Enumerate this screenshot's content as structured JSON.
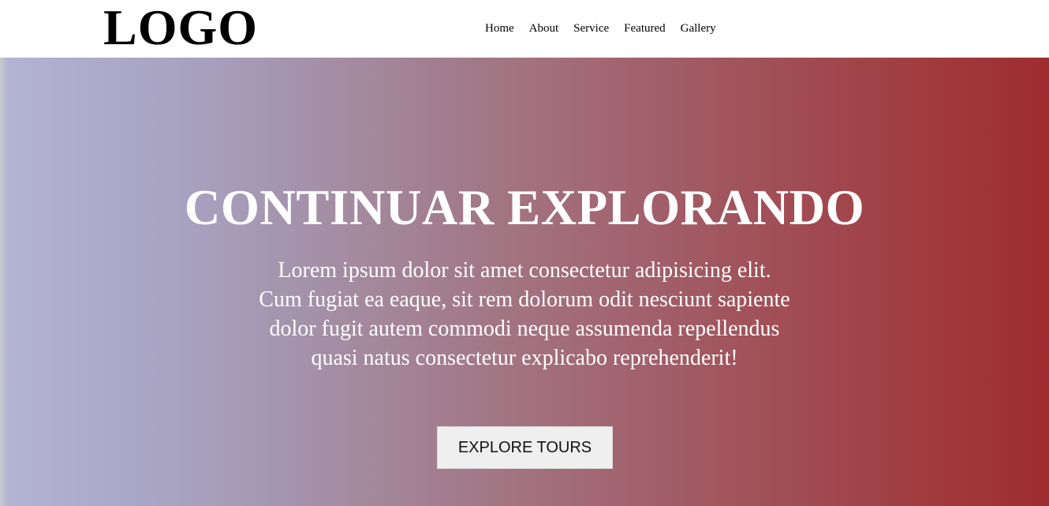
{
  "header": {
    "logo": "LOGO",
    "nav": [
      "Home",
      "About",
      "Service",
      "Featured",
      "Gallery"
    ]
  },
  "hero": {
    "title": "CONTINUAR EXPLORANDO",
    "text": "Lorem ipsum dolor sit amet consectetur adipisicing elit. Cum fugiat ea eaque, sit rem dolorum odit nesciunt sapiente dolor fugit autem commodi neque assumenda repellendus quasi natus consectetur explicabo reprehenderit!",
    "button_label": "EXPLORE TOURS"
  },
  "colors": {
    "header_bg": "#ffffff",
    "gradient_start": "#b3b3d3",
    "gradient_end": "#9f2c2d",
    "button_bg": "#efefef"
  }
}
